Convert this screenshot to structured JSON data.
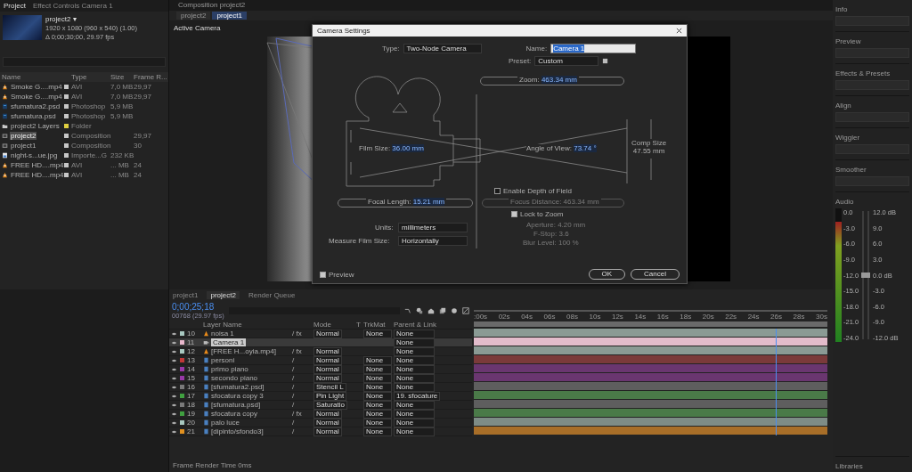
{
  "project": {
    "tabs": [
      {
        "label": "Project",
        "selected": true
      },
      {
        "label": "Effect Controls Camera 1",
        "selected": false
      }
    ],
    "comp_name": "project2 ▾",
    "comp_info": [
      "1920 x 1080 (960 x 540) (1.00)",
      "Δ 0;00;30;00, 29.97 fps"
    ],
    "columns": [
      "Name",
      "Type",
      "Size",
      "Frame R..."
    ],
    "items": [
      {
        "name": "Smoke G....mp4",
        "kind": "video",
        "type": "AVI",
        "size": "7,0 MB",
        "frame_rate": "29,97",
        "color": "#c8c8c8",
        "selected": false
      },
      {
        "name": "Smoke G....mp4",
        "kind": "video",
        "type": "AVI",
        "size": "7,0 MB",
        "frame_rate": "29,97",
        "color": "#c8c8c8",
        "selected": false
      },
      {
        "name": "sfumatura2.psd",
        "kind": "psd",
        "type": "Photoshop",
        "size": "5,9 MB",
        "color": "#c8c8c8",
        "selected": false
      },
      {
        "name": "sfumatura.psd",
        "kind": "psd",
        "type": "Photoshop",
        "size": "5,9 MB",
        "color": "#c8c8c8",
        "selected": false
      },
      {
        "name": "project2 Layers",
        "kind": "folder",
        "type": "Folder",
        "color": "#e0d040",
        "selected": false
      },
      {
        "name": "project2",
        "kind": "comp",
        "type": "Composition",
        "frame_rate": "29,97",
        "color": "#c8c8c8",
        "selected": true
      },
      {
        "name": "project1",
        "kind": "comp",
        "type": "Composition",
        "frame_rate": "30",
        "color": "#c8c8c8",
        "selected": false
      },
      {
        "name": "night-s...ue.jpg",
        "kind": "image",
        "type": "Importe...G",
        "size": "232 KB",
        "color": "#c8c8c8",
        "selected": false
      },
      {
        "name": "FREE HD....mp4",
        "kind": "video",
        "type": "AVI",
        "size": "... MB",
        "frame_rate": "24",
        "color": "#c8c8c8",
        "selected": false
      },
      {
        "name": "FREE HD....mp4",
        "kind": "video",
        "type": "AVI",
        "size": "... MB",
        "frame_rate": "24",
        "color": "#c8c8c8",
        "selected": false
      }
    ]
  },
  "viewer": {
    "panel_title": "Composition project2",
    "tabs": [
      {
        "label": "project2",
        "selected": false
      },
      {
        "label": "project1",
        "selected": true
      }
    ],
    "view_label": "Active Camera"
  },
  "dialog": {
    "title": "Camera Settings",
    "type_label": "Type:",
    "type": "Two-Node Camera",
    "name_label": "Name:",
    "name": "Camera 1",
    "preset_label": "Preset:",
    "preset": "Custom",
    "zoom_label": "Zoom:",
    "zoom": "463.34 mm",
    "film_size_label": "Film Size:",
    "film_size": "36.00 mm",
    "angle_label": "Angle of View:",
    "angle": "73.74 °",
    "comp_size_label": "Comp Size",
    "comp_size": "47.55 mm",
    "focal_label": "Focal Length:",
    "focal": "15.21 mm",
    "dof": {
      "label": "Enable Depth of Field",
      "checked": false
    },
    "focus_label": "Focus Distance:",
    "focus": "463.34 mm",
    "lock": {
      "label": "Lock to Zoom",
      "checked": true
    },
    "aperture_label": "Aperture:",
    "aperture": "4.20 mm",
    "fstop_label": "F-Stop:",
    "fstop": "3.6",
    "blur_label": "Blur Level:",
    "blur": "100 %",
    "units_label": "Units:",
    "units": "millimeters",
    "measure_label": "Measure Film Size:",
    "measure": "Horizontally",
    "preview": {
      "label": "Preview",
      "checked": true
    },
    "ok": "OK",
    "cancel": "Cancel"
  },
  "timeline": {
    "tabs": [
      {
        "label": "project1",
        "selected": false
      },
      {
        "label": "project2",
        "selected": true
      },
      {
        "label": "Render Queue",
        "selected": false
      }
    ],
    "time": "0;00;25;18",
    "frames": "00768 (29.97 fps)",
    "columns": [
      "Layer Name",
      "Mode",
      "T",
      "TrkMat",
      "Parent & Link"
    ],
    "ruler": [
      ":00s",
      "02s",
      "04s",
      "06s",
      "08s",
      "10s",
      "12s",
      "14s",
      "16s",
      "18s",
      "20s",
      "22s",
      "24s",
      "26s",
      "28s",
      "30s"
    ],
    "playhead": {
      "level": 0.853
    },
    "layers": [
      {
        "index": "10",
        "name": "noisa 1",
        "kind": "video",
        "color": "#a8c8c0",
        "switches": "/ fx",
        "mode": "Normal",
        "trkmat": "None",
        "parent": "None",
        "selected": false,
        "bar": {
          "color": "#8a9a94"
        }
      },
      {
        "index": "11",
        "name": "Camera 1",
        "kind": "camera",
        "color": "#e8b8cc",
        "parent": "None",
        "selected": true,
        "bar": {
          "color": "#e2bccb"
        }
      },
      {
        "index": "12",
        "name": "[FREE H...oyia.mp4]",
        "kind": "video",
        "color": "#a8c8c0",
        "switches": "/ fx",
        "mode": "Normal",
        "parent": "None",
        "selected": false,
        "bar": {
          "color": "#8a9a94"
        }
      },
      {
        "index": "13",
        "name": "personi",
        "kind": "footage",
        "color": "#c03838",
        "switches": "/",
        "mode": "Normal",
        "trkmat": "None",
        "parent": "None",
        "selected": false,
        "bar": {
          "color": "#7a3a3a"
        }
      },
      {
        "index": "14",
        "name": "primo piano",
        "kind": "footage",
        "color": "#9838a8",
        "switches": "/",
        "mode": "Normal",
        "trkmat": "None",
        "parent": "None",
        "selected": false,
        "bar": {
          "color": "#6a3670"
        }
      },
      {
        "index": "15",
        "name": "secondo piano",
        "kind": "footage",
        "color": "#9838a8",
        "switches": "/",
        "mode": "Normal",
        "trkmat": "None",
        "parent": "None",
        "selected": false,
        "bar": {
          "color": "#6a3670"
        }
      },
      {
        "index": "16",
        "name": "[sfumatura2.psd]",
        "kind": "footage",
        "color": "#7a7a7a",
        "switches": "/",
        "mode": "Stencil L",
        "trkmat": "None",
        "parent": "None",
        "selected": false,
        "bar": {
          "color": "#5e5e5e"
        }
      },
      {
        "index": "17",
        "name": "sfocatura copy 3",
        "kind": "footage",
        "color": "#40a040",
        "switches": "/",
        "mode": "Pin Light",
        "trkmat": "None",
        "parent": "19. sfocature",
        "selected": false,
        "bar": {
          "color": "#4a7a48"
        }
      },
      {
        "index": "18",
        "name": "[sfumatura.psd]",
        "kind": "footage",
        "color": "#7a7a7a",
        "switches": "/",
        "mode": "Saturatio",
        "trkmat": "None",
        "parent": "None",
        "selected": false,
        "bar": {
          "color": "#5e5e5e"
        }
      },
      {
        "index": "19",
        "name": "sfocatura copy",
        "kind": "footage",
        "color": "#40a040",
        "switches": "/ fx",
        "mode": "Normal",
        "trkmat": "None",
        "parent": "None",
        "selected": false,
        "bar": {
          "color": "#4a7a48"
        }
      },
      {
        "index": "20",
        "name": "palo luce",
        "kind": "footage",
        "color": "#a8c8c0",
        "switches": "/",
        "mode": "Normal",
        "trkmat": "None",
        "parent": "None",
        "selected": false,
        "bar": {
          "color": "#7e8c86"
        }
      },
      {
        "index": "21",
        "name": "[dipinto/sfondo3]",
        "kind": "footage",
        "color": "#e09020",
        "switches": "/",
        "mode": "Normal",
        "trkmat": "None",
        "parent": "None",
        "selected": false,
        "bar": {
          "color": "#a86e28"
        }
      }
    ],
    "footer": "Frame Render Time 0ms"
  },
  "right_panel": {
    "sections": [
      "Info",
      "Preview",
      "Effects & Presets",
      "Align",
      "Wiggler",
      "Smoother"
    ],
    "audio": {
      "title": "Audio",
      "left_scale": [
        "0.0",
        "-3.0",
        "-6.0",
        "-9.0",
        "-12.0",
        "-15.0",
        "-18.0",
        "-21.0",
        "-24.0"
      ],
      "right_scale": [
        "12.0 dB",
        "9.0",
        "6.0",
        "3.0",
        "0.0 dB",
        "-3.0",
        "-6.0",
        "-9.0",
        "-12.0 dB"
      ],
      "level": 0.9
    },
    "libraries": "Libraries"
  }
}
